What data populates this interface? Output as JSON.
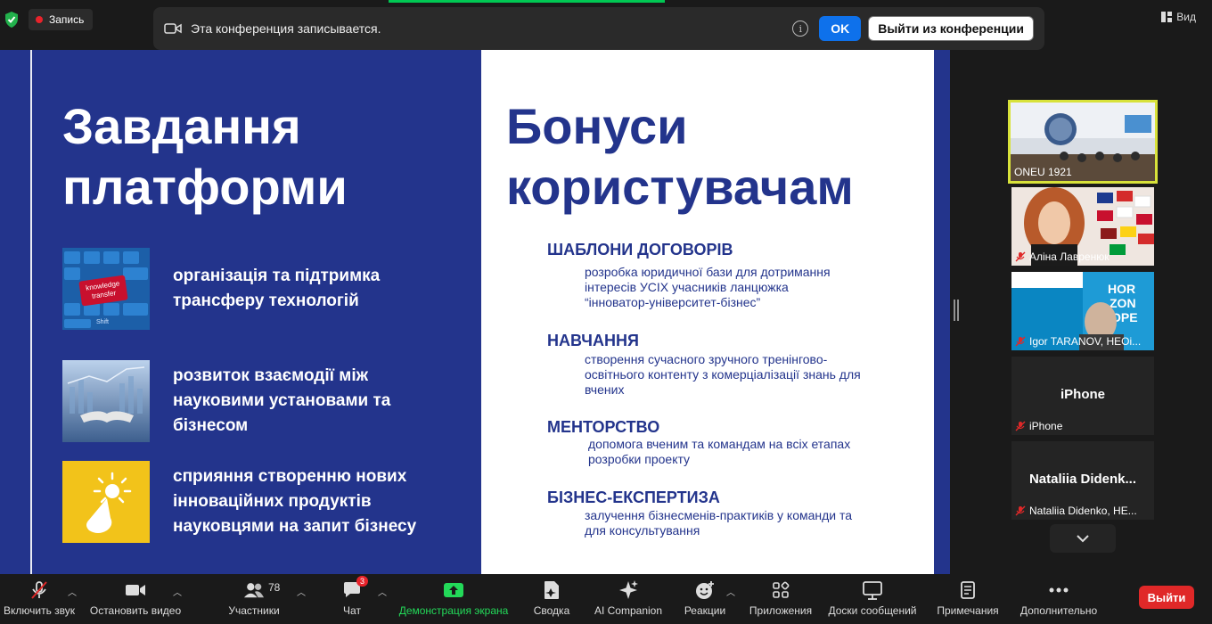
{
  "top": {
    "recording_label": "Запись",
    "view_label": "Вид"
  },
  "banner": {
    "text": "Эта конференция записывается.",
    "ok_label": "OK",
    "leave_label": "Выйти из конференции"
  },
  "slide": {
    "left_title": [
      "Завдання",
      "платформи"
    ],
    "tasks": [
      {
        "text": [
          "організація та підтримка",
          "трансферу технологій"
        ],
        "image_caption": [
          "knowledge",
          "transfer"
        ],
        "image_key": "Shift"
      },
      {
        "text": [
          "розвиток взаємодії між",
          "науковими установами та",
          "бізнесом"
        ]
      },
      {
        "text": [
          "сприяння створенню нових",
          "інноваційних продуктів",
          "науковцями на запит бізнесу"
        ]
      }
    ],
    "right_title": [
      "Бонуси",
      "користувачам"
    ],
    "bonuses": [
      {
        "heading": "ШАБЛОНИ ДОГОВОРІВ",
        "desc": [
          "розробка юридичної бази для дотримання",
          "інтересів УСІХ учасників ланцюжка",
          "“інноватор-університет-бізнес”"
        ]
      },
      {
        "heading": "НАВЧАННЯ",
        "desc": [
          "створення сучасного зручного тренінгово-",
          "освітнього контенту з комерціалізації знань для",
          "вчених"
        ]
      },
      {
        "heading": "МЕНТОРСТВО",
        "desc": [
          "допомога вченим та командам  на всіх етапах",
          "розробки проекту"
        ]
      },
      {
        "heading": "БІЗНЕС-ЕКСПЕРТИЗА",
        "desc": [
          "залучення бізнесменів-практиків у команди та",
          "для консультування"
        ]
      }
    ]
  },
  "participants": [
    {
      "name": "ONEU 1921",
      "muted": false,
      "active": true
    },
    {
      "name": "Аліна Лавренюк",
      "muted": true
    },
    {
      "name": "Igor TARANOV, HEOi...",
      "muted": true,
      "poster_text": [
        "HOR",
        "ZON",
        "OPE"
      ]
    },
    {
      "name": "iPhone",
      "center": "iPhone",
      "muted": true
    },
    {
      "name": "Nataliia Didenko, HE...",
      "center": "Nataliia  Didenk...",
      "muted": true
    }
  ],
  "toolbar": {
    "mute": "Включить звук",
    "video": "Остановить видео",
    "participants": "Участники",
    "participants_count": "78",
    "chat": "Чат",
    "chat_badge": "3",
    "share": "Демонстрация экрана",
    "summary": "Сводка",
    "ai": "AI Companion",
    "reactions": "Реакции",
    "apps": "Приложения",
    "whiteboards": "Доски сообщений",
    "notes": "Примечания",
    "more": "Дополнительно",
    "end": "Выйти"
  },
  "colors": {
    "slide_blue": "#23348c",
    "zoom_blue": "#0e71eb",
    "share_green": "#23d959",
    "end_red": "#e02828"
  }
}
